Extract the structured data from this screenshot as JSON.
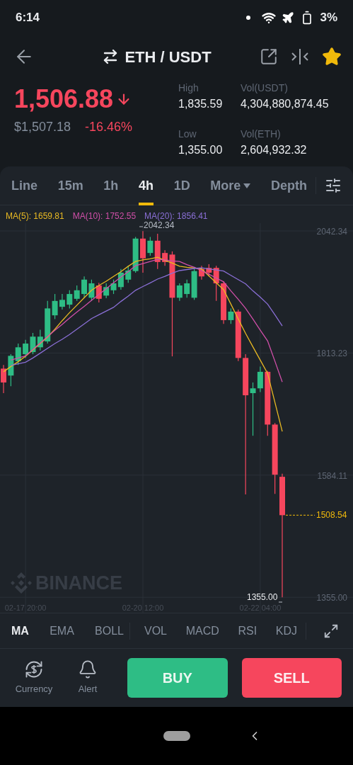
{
  "status_bar": {
    "time": "6:14",
    "battery": "3%"
  },
  "header": {
    "title": "ETH / USDT",
    "favorite": true
  },
  "ticker": {
    "price": "1,506.88",
    "falling": true,
    "fiat_price": "$1,507.18",
    "change": "-16.46%",
    "stats": [
      {
        "label": "High",
        "value": "1,835.59"
      },
      {
        "label": "Vol(USDT)",
        "value": "4,304,880,874.45"
      },
      {
        "label": "Low",
        "value": "1,355.00"
      },
      {
        "label": "Vol(ETH)",
        "value": "2,604,932.32"
      }
    ]
  },
  "intervals": [
    {
      "label": "Line",
      "selected": false,
      "kind": "option"
    },
    {
      "label": "15m",
      "selected": false,
      "kind": "option"
    },
    {
      "label": "1h",
      "selected": false,
      "kind": "option"
    },
    {
      "label": "4h",
      "selected": true,
      "kind": "option"
    },
    {
      "label": "1D",
      "selected": false,
      "kind": "option"
    },
    {
      "label": "More",
      "selected": false,
      "kind": "dropdown"
    },
    {
      "label": "Depth",
      "selected": false,
      "kind": "option"
    }
  ],
  "chart": {
    "chart_data": {
      "type": "candlestick",
      "grid": true,
      "categories": [
        null,
        null,
        null,
        "02-17 20:00",
        null,
        null,
        null,
        null,
        null,
        null,
        null,
        null,
        null,
        null,
        null,
        null,
        null,
        null,
        null,
        "02-20 12:00",
        null,
        null,
        null,
        null,
        null,
        null,
        null,
        null,
        null,
        null,
        null,
        null,
        null,
        null,
        null,
        "02-22 04:00",
        null,
        null,
        null
      ],
      "ylim": [
        1326,
        2057
      ],
      "yticks": [
        {
          "value": 2042.34,
          "label": "2042.34"
        },
        {
          "value": 1813.23,
          "label": "1813.23"
        },
        {
          "value": 1584.11,
          "label": "1584.11"
        },
        {
          "value": 1355,
          "label": "1355.00"
        }
      ],
      "ohlc": [
        [
          1784,
          1791,
          1738,
          1758
        ],
        [
          1771,
          1811,
          1751,
          1808
        ],
        [
          1798,
          1831,
          1791,
          1824
        ],
        [
          1811,
          1838,
          1804,
          1831
        ],
        [
          1815,
          1851,
          1811,
          1844
        ],
        [
          1824,
          1857,
          1818,
          1844
        ],
        [
          1835,
          1911,
          1831,
          1897
        ],
        [
          1884,
          1924,
          1877,
          1911
        ],
        [
          1900,
          1924,
          1895,
          1913
        ],
        [
          1904,
          1931,
          1897,
          1924
        ],
        [
          1915,
          1940,
          1911,
          1931
        ],
        [
          1924,
          1957,
          1917,
          1951
        ],
        [
          1917,
          1951,
          1911,
          1944
        ],
        [
          1940,
          1945,
          1908,
          1915
        ],
        [
          1921,
          1944,
          1916,
          1937
        ],
        [
          1931,
          1951,
          1924,
          1944
        ],
        [
          1937,
          1971,
          1932,
          1964
        ],
        [
          1951,
          1977,
          1945,
          1968
        ],
        [
          1967,
          2031,
          1964,
          2028
        ],
        [
          2028,
          2042,
          1964,
          1991
        ],
        [
          2001,
          2031,
          1996,
          2024
        ],
        [
          2024,
          2037,
          1971,
          1984
        ],
        [
          2001,
          2006,
          1977,
          1984
        ],
        [
          1998,
          2004,
          1807,
          1917
        ],
        [
          1917,
          1944,
          1911,
          1940
        ],
        [
          1924,
          1951,
          1917,
          1944
        ],
        [
          1917,
          1975,
          1913,
          1967
        ],
        [
          1971,
          1977,
          1951,
          1957
        ],
        [
          1973,
          1980,
          1957,
          1964
        ],
        [
          1973,
          1977,
          1911,
          1944
        ],
        [
          1944,
          1948,
          1868,
          1875
        ],
        [
          1875,
          1897,
          1868,
          1891
        ],
        [
          1891,
          1895,
          1798,
          1804
        ],
        [
          1804,
          1811,
          1548,
          1734
        ],
        [
          1738,
          1758,
          1658,
          1747
        ],
        [
          1747,
          1788,
          1740,
          1778
        ],
        [
          1778,
          1780,
          1658,
          1679
        ],
        [
          1679,
          1682,
          1549,
          1585
        ],
        [
          1581,
          1587,
          1355,
          1509
        ]
      ],
      "series": [
        {
          "name": "MA(5): 1659.81",
          "type": "line",
          "color": "#e8b923",
          "values": [
            1778,
            1788,
            1797,
            1807,
            1819,
            1831,
            1843,
            1858,
            1874,
            1889,
            1903,
            1917,
            1931,
            1940,
            1948,
            1957,
            1966,
            1976,
            1985,
            1988,
            1990,
            1993,
            1987,
            1982,
            1976,
            1974,
            1973,
            1971,
            1958,
            1945,
            1932,
            1905,
            1877,
            1850,
            1825,
            1800,
            1775,
            1721,
            1666
          ]
        },
        {
          "name": "MA(10): 1752.55",
          "type": "line",
          "color": "#d04fa8",
          "values": [
            null,
            1800,
            1804,
            1808,
            1820,
            1832,
            1844,
            1856,
            1867,
            1879,
            1890,
            1901,
            1912,
            1923,
            1934,
            1945,
            1956,
            1966,
            1977,
            1981,
            1985,
            1989,
            1988,
            1986,
            1985,
            1979,
            1974,
            1968,
            1961,
            1954,
            1947,
            1930,
            1914,
            1897,
            1877,
            1856,
            1836,
            1798,
            1759
          ]
        },
        {
          "name": "MA(20): 1856.41",
          "type": "line",
          "color": "#8a6fd6",
          "values": [
            null,
            1790,
            1793,
            1796,
            1804,
            1813,
            1822,
            1831,
            1839,
            1848,
            1858,
            1868,
            1878,
            1885,
            1892,
            1899,
            1910,
            1920,
            1931,
            1938,
            1945,
            1952,
            1957,
            1963,
            1968,
            1970,
            1972,
            1973,
            1971,
            1969,
            1967,
            1959,
            1951,
            1943,
            1930,
            1918,
            1905,
            1885,
            1864
          ]
        }
      ]
    },
    "high_marker": "2042.34",
    "low_marker": "1355.00",
    "last_price": "1508.54",
    "watermark": "BINANCE"
  },
  "indicator_groups": [
    {
      "items": [
        {
          "label": "MA",
          "selected": true
        },
        {
          "label": "EMA",
          "selected": false
        },
        {
          "label": "BOLL",
          "selected": false
        }
      ]
    },
    {
      "items": [
        {
          "label": "VOL",
          "selected": false
        },
        {
          "label": "MACD",
          "selected": false
        },
        {
          "label": "RSI",
          "selected": false
        },
        {
          "label": "KDJ",
          "selected": false
        }
      ]
    }
  ],
  "actions": [
    {
      "label": "Currency",
      "kind": "currency"
    },
    {
      "label": "Alert",
      "kind": "alert"
    }
  ],
  "buy": "BUY",
  "sell": "SELL"
}
